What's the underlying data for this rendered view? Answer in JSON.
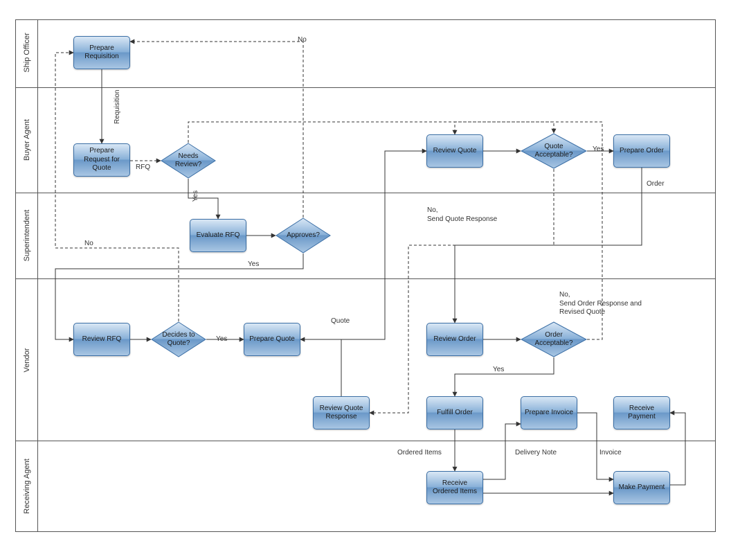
{
  "lanes": {
    "l1": "Ship Officer",
    "l2": "Buyer Agent",
    "l3": "Superintendent",
    "l4": "Vendor",
    "l5": "Receiving Agent"
  },
  "nodes": {
    "prepare_requisition": "Prepare Requisition",
    "prepare_rfq": "Prepare Request for Quote",
    "needs_review": "Needs Review?",
    "evaluate_rfq": "Evaluate RFQ",
    "approves": "Approves?",
    "review_rfq": "Review RFQ",
    "decides_to_quote": "Decides to Quote?",
    "prepare_quote": "Prepare Quote",
    "review_quote": "Review Quote",
    "quote_acceptable": "Quote Acceptable?",
    "prepare_order": "Prepare Order",
    "review_order": "Review Order",
    "order_acceptable": "Order Acceptable?",
    "review_quote_response": "Review Quote Response",
    "fulfill_order": "Fulfill Order",
    "prepare_invoice": "Prepare Invoice",
    "receive_payment": "Receive Payment",
    "receive_ordered_items": "Receive Ordered Items",
    "make_payment": "Make Payment"
  },
  "labels": {
    "requisition": "Requisition",
    "rfq": "RFQ",
    "yes": "Yes",
    "no": "No",
    "quote": "Quote",
    "no_send_quote_response": "No,\nSend Quote Response",
    "order": "Order",
    "no_send_order_response": "No,\nSend Order Response and\nRevised Quote",
    "ordered_items": "Ordered Items",
    "delivery_note": "Delivery Note",
    "invoice": "Invoice"
  }
}
